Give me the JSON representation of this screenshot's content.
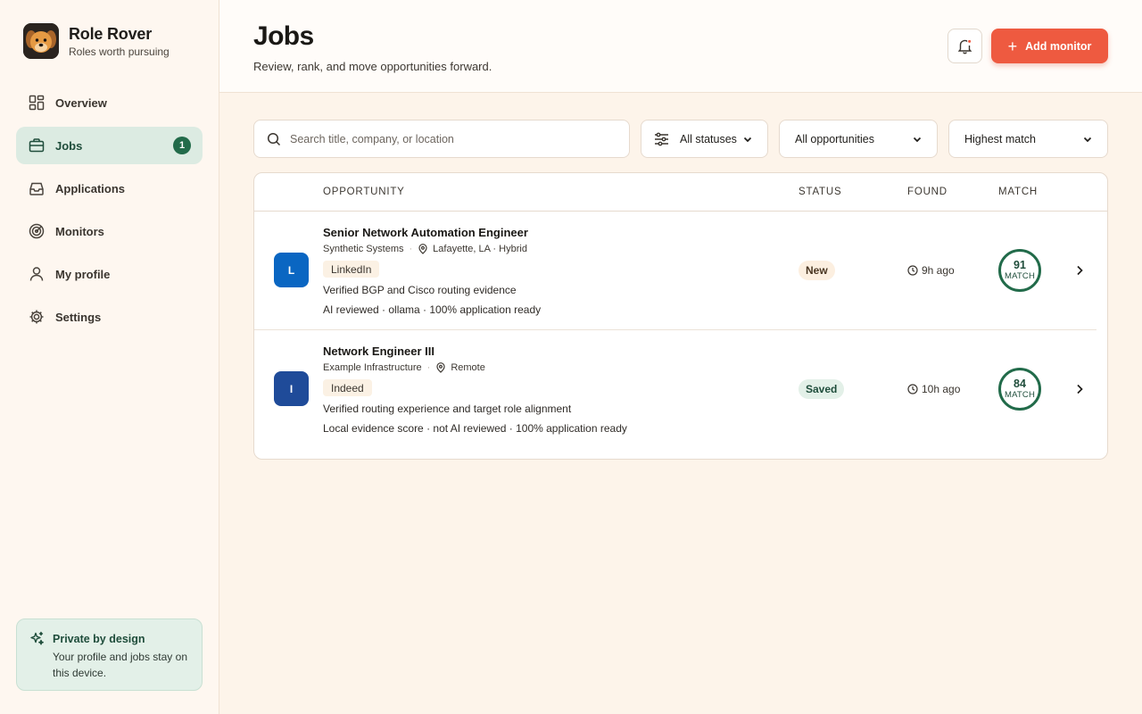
{
  "brand": {
    "name": "Role Rover",
    "tagline": "Roles worth pursuing"
  },
  "nav": {
    "items": [
      {
        "label": "Overview",
        "icon": "grid-icon"
      },
      {
        "label": "Jobs",
        "icon": "briefcase-icon",
        "badge": "1",
        "active": true
      },
      {
        "label": "Applications",
        "icon": "inbox-icon"
      },
      {
        "label": "Monitors",
        "icon": "radar-icon"
      },
      {
        "label": "My profile",
        "icon": "user-icon"
      },
      {
        "label": "Settings",
        "icon": "gear-icon"
      }
    ]
  },
  "privacy": {
    "title": "Private by design",
    "text": "Your profile and jobs stay on this device."
  },
  "header": {
    "title": "Jobs",
    "subtitle": "Review, rank, and move opportunities forward.",
    "add_label": "Add monitor"
  },
  "filters": {
    "search_placeholder": "Search title, company, or location",
    "status": "All statuses",
    "opportunity": "All opportunities",
    "sort": "Highest match"
  },
  "table": {
    "columns": {
      "opportunity": "OPPORTUNITY",
      "status": "STATUS",
      "found": "FOUND",
      "match": "MATCH"
    },
    "rows": [
      {
        "initial": "L",
        "title": "Senior Network Automation Engineer",
        "company": "Synthetic Systems",
        "location": "Lafayette, LA · Hybrid",
        "source": "LinkedIn",
        "reason": "Verified BGP and Cisco routing evidence",
        "review": "AI reviewed · ollama · 100% application ready",
        "status": "New",
        "found": "9h ago",
        "match": "91",
        "match_label": "MATCH"
      },
      {
        "initial": "I",
        "title": "Network Engineer III",
        "company": "Example Infrastructure",
        "location": "Remote",
        "source": "Indeed",
        "reason": "Verified routing experience and target role alignment",
        "review": "Local evidence score · not AI reviewed · 100% application ready",
        "status": "Saved",
        "found": "10h ago",
        "match": "84",
        "match_label": "MATCH"
      }
    ]
  },
  "colors": {
    "accent": "#ee5a40",
    "brand_green": "#226b4a",
    "linkedin_blue": "#0a66c2",
    "indeed_blue": "#1f4b99",
    "background": "#fdf4ea"
  }
}
